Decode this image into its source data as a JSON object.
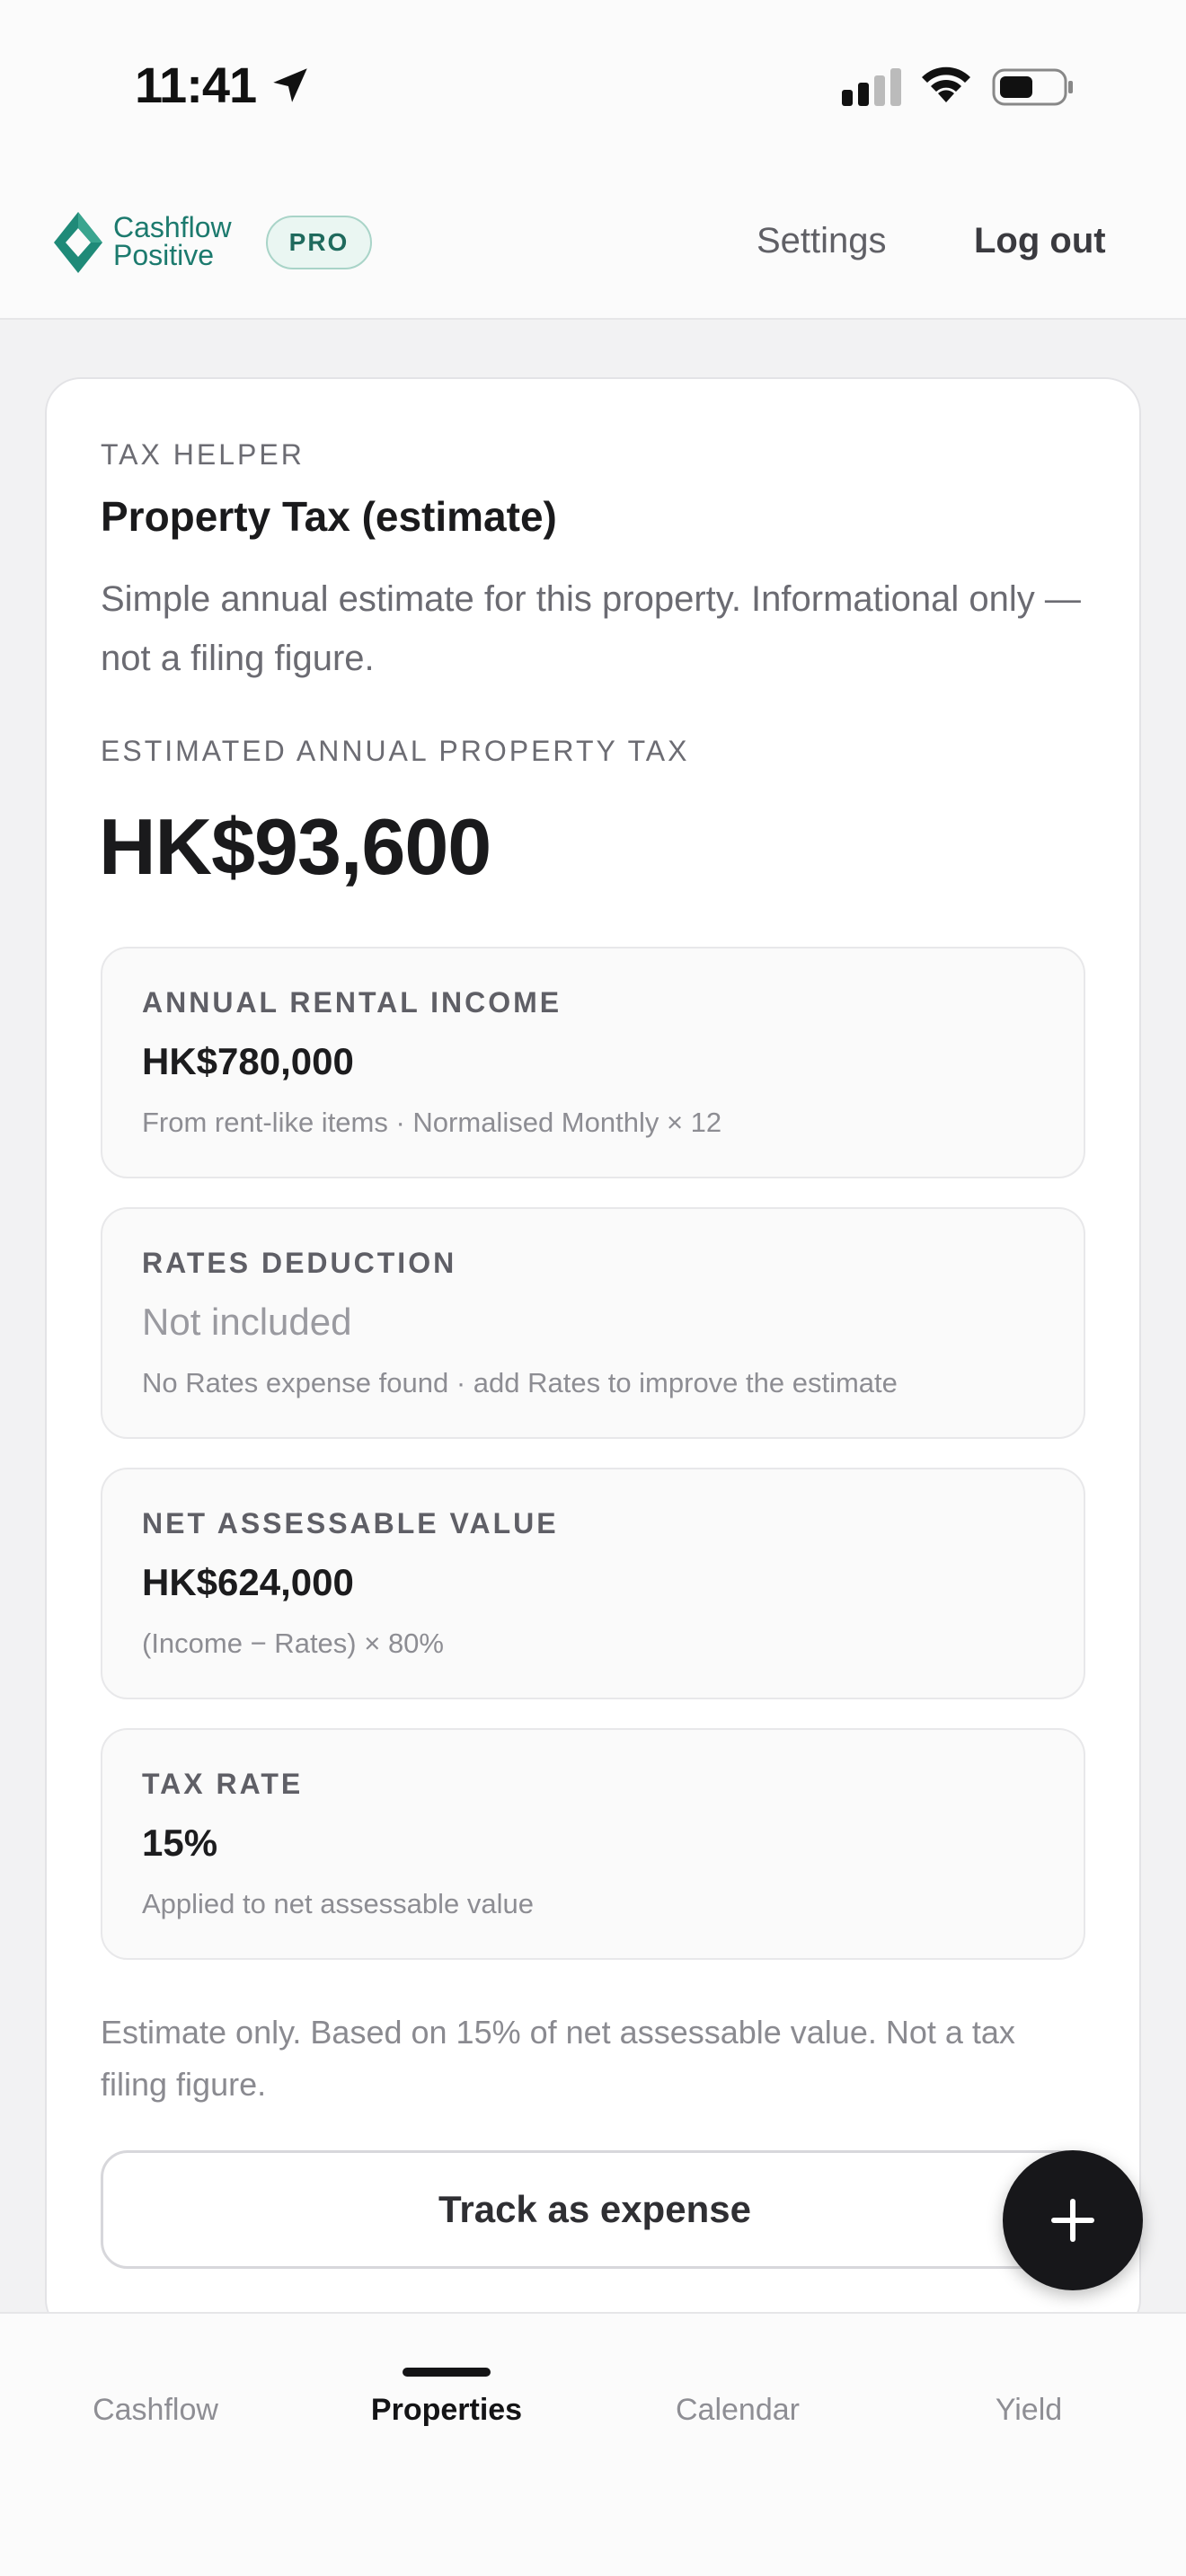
{
  "status_bar": {
    "time": "11:41"
  },
  "header": {
    "brand_line1": "Cashflow",
    "brand_line2": "Positive",
    "badge": "PRO",
    "settings": "Settings",
    "logout": "Log out"
  },
  "card": {
    "eyebrow": "TAX HELPER",
    "title": "Property Tax (estimate)",
    "description": "Simple annual estimate for this property. Informational only — not a filing figure.",
    "estimate_label": "ESTIMATED ANNUAL PROPERTY TAX",
    "estimate_value": "HK$93,600",
    "items": [
      {
        "label": "ANNUAL RENTAL INCOME",
        "value": "HK$780,000",
        "note": "From rent-like items · Normalised Monthly × 12"
      },
      {
        "label": "RATES DEDUCTION",
        "value": "Not included",
        "note": "No Rates expense found · add Rates to improve the estimate"
      },
      {
        "label": "NET ASSESSABLE VALUE",
        "value": "HK$624,000",
        "note": "(Income − Rates) × 80%"
      },
      {
        "label": "TAX RATE",
        "value": "15%",
        "note": "Applied to net assessable value"
      }
    ],
    "footnote": "Estimate only. Based on 15% of net assessable value. Not a tax filing figure.",
    "track_button": "Track as expense"
  },
  "fab": {
    "icon": "plus-icon"
  },
  "bottom_nav": {
    "items": [
      {
        "label": "Cashflow",
        "active": false
      },
      {
        "label": "Properties",
        "active": true
      },
      {
        "label": "Calendar",
        "active": false
      },
      {
        "label": "Yield",
        "active": false
      }
    ]
  },
  "colors": {
    "brand": "#1c7a6e",
    "fab": "#17171a",
    "page_bg": "#f2f2f3"
  }
}
